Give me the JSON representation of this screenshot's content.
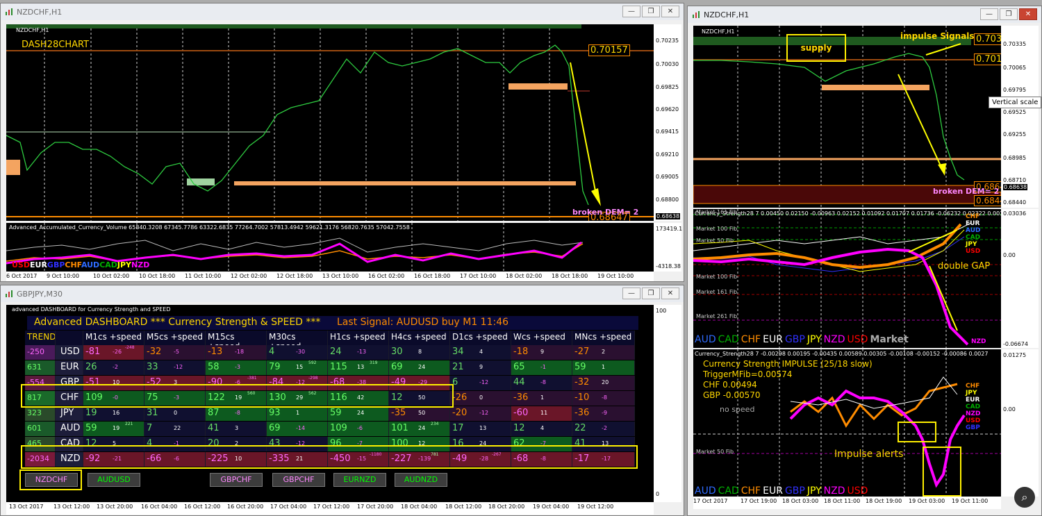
{
  "windows": {
    "top_left": {
      "title": "NZDCHF,H1"
    },
    "right": {
      "title": "NZDCHF,H1"
    },
    "bottom_left": {
      "title": "GBPJPY,M30"
    }
  },
  "top_left_chart": {
    "symbol": "NZDCHF,H1",
    "label": "DASH28CHART",
    "price_box": "0.70157",
    "price_box_low": "0.68647",
    "broken": "broken DEM= 2",
    "prices": [
      "0.70235",
      "0.70030",
      "0.69825",
      "0.69620",
      "0.69415",
      "0.69210",
      "0.69005",
      "0.68800",
      "0.68638"
    ],
    "indicator_text": "Advanced_Accumulated_Currency_Volume 65840.3208 67345.7786 63322.6835 77264.7002 57813.4942 59621.3176 56820.7635 57042.7558",
    "indicator_scale_top": "173419.1",
    "indicator_scale_bottom": "-4318.38",
    "currencies": [
      "USD",
      "EUR",
      "GBP",
      "CHF",
      "AUD",
      "CAD",
      "JPY",
      "NZD"
    ],
    "times": [
      "6 Oct 2017",
      "9 Oct 10:00",
      "10 Oct 02:00",
      "10 Oct 18:00",
      "11 Oct 10:00",
      "12 Oct 02:00",
      "12 Oct 18:00",
      "13 Oct 10:00",
      "16 Oct 02:00",
      "16 Oct 18:00",
      "17 Oct 10:00",
      "18 Oct 02:00",
      "18 Oct 18:00",
      "19 Oct 10:00"
    ]
  },
  "dashboard": {
    "caption": "advanced DASHBOARD for Currency Strength and SPEED",
    "title": "Advanced  DASHBOARD *** Currency Strength & SPEED ***",
    "last_signal": "Last Signal: AUDUSD buy M1 11:46",
    "scale_top": "100",
    "scale_bottom": "0",
    "headers": [
      "TREND",
      "",
      "M1cs +speed",
      "M5cs +speed",
      "M15cs +speed",
      "M30cs +speed",
      "H1cs +speed",
      "H4cs +speed",
      "D1cs +speed",
      "Wcs +speed",
      "MNcs +speed"
    ],
    "rows": [
      {
        "trend": "-250",
        "cur": "USD",
        "cells": [
          [
            "-81",
            "-26",
            "-248"
          ],
          [
            "-32",
            "-5",
            ""
          ],
          [
            "-13",
            "-18",
            ""
          ],
          [
            "4",
            "-30",
            ""
          ],
          [
            "24",
            "-13",
            ""
          ],
          [
            "30",
            "8",
            ""
          ],
          [
            "34",
            "4",
            ""
          ],
          [
            "-18",
            "9",
            ""
          ],
          [
            "-27",
            "2",
            ""
          ]
        ]
      },
      {
        "trend": "631",
        "cur": "EUR",
        "cells": [
          [
            "26",
            "-2",
            ""
          ],
          [
            "33",
            "-12",
            ""
          ],
          [
            "58",
            "-3",
            ""
          ],
          [
            "79",
            "15",
            "592"
          ],
          [
            "115",
            "13",
            "319"
          ],
          [
            "69",
            "24",
            ""
          ],
          [
            "21",
            "9",
            ""
          ],
          [
            "65",
            "-1",
            ""
          ],
          [
            "59",
            "1",
            ""
          ]
        ]
      },
      {
        "trend": "-554",
        "cur": "GBP",
        "cells": [
          [
            "-51",
            "10",
            ""
          ],
          [
            "-52",
            "3",
            ""
          ],
          [
            "-90",
            "-6",
            "-381"
          ],
          [
            "-84",
            "-12",
            "-298"
          ],
          [
            "-68",
            "-38",
            ""
          ],
          [
            "-49",
            "-29",
            ""
          ],
          [
            "6",
            "-12",
            ""
          ],
          [
            "44",
            "-8",
            ""
          ],
          [
            "-32",
            "20",
            ""
          ]
        ]
      },
      {
        "trend": "817",
        "cur": "CHF",
        "cells": [
          [
            "109",
            "-0",
            ""
          ],
          [
            "75",
            "-3",
            ""
          ],
          [
            "122",
            "19",
            "560"
          ],
          [
            "130",
            "29",
            "562"
          ],
          [
            "116",
            "42",
            ""
          ],
          [
            "12",
            "50",
            ""
          ],
          [
            "-26",
            "0",
            ""
          ],
          [
            "-36",
            "1",
            ""
          ],
          [
            "-10",
            "-8",
            ""
          ]
        ]
      },
      {
        "trend": "323",
        "cur": "JPY",
        "cells": [
          [
            "19",
            "16",
            ""
          ],
          [
            "31",
            "0",
            ""
          ],
          [
            "87",
            "-8",
            ""
          ],
          [
            "93",
            "1",
            ""
          ],
          [
            "59",
            "24",
            ""
          ],
          [
            "-35",
            "50",
            ""
          ],
          [
            "-20",
            "-12",
            ""
          ],
          [
            "-60",
            "11",
            ""
          ],
          [
            "-36",
            "-9",
            ""
          ]
        ]
      },
      {
        "trend": "601",
        "cur": "AUD",
        "cells": [
          [
            "59",
            "19",
            "221"
          ],
          [
            "7",
            "22",
            ""
          ],
          [
            "41",
            "3",
            ""
          ],
          [
            "69",
            "-14",
            ""
          ],
          [
            "109",
            "-6",
            ""
          ],
          [
            "101",
            "24",
            "234"
          ],
          [
            "17",
            "13",
            ""
          ],
          [
            "12",
            "4",
            ""
          ],
          [
            "22",
            "-2",
            ""
          ]
        ]
      },
      {
        "trend": "465",
        "cur": "CAD",
        "cells": [
          [
            "12",
            "5",
            ""
          ],
          [
            "4",
            "-1",
            ""
          ],
          [
            "20",
            "2",
            ""
          ],
          [
            "43",
            "-12",
            ""
          ],
          [
            "96",
            "-7",
            ""
          ],
          [
            "100",
            "12",
            ""
          ],
          [
            "16",
            "24",
            ""
          ],
          [
            "62",
            "-7",
            ""
          ],
          [
            "41",
            "13",
            ""
          ]
        ]
      },
      {
        "trend": "-2034",
        "cur": "NZD",
        "cells": [
          [
            "-92",
            "-21",
            ""
          ],
          [
            "-66",
            "-6",
            ""
          ],
          [
            "-225",
            "10",
            ""
          ],
          [
            "-335",
            "21",
            ""
          ],
          [
            "-450",
            "-15",
            "-1180"
          ],
          [
            "-227",
            "-139",
            "781"
          ],
          [
            "-49",
            "-28",
            "-267"
          ],
          [
            "-68",
            "-8",
            ""
          ],
          [
            "-17",
            "-17",
            ""
          ]
        ]
      }
    ],
    "buttons": [
      "NZDCHF",
      "AUDUSD",
      "GBPCHF",
      "GBPCHF",
      "EURNZD",
      "AUDNZD"
    ],
    "times": [
      "13 Oct 2017",
      "13 Oct 12:00",
      "13 Oct 20:00",
      "16 Oct 04:00",
      "16 Oct 12:00",
      "16 Oct 20:00",
      "17 Oct 04:00",
      "17 Oct 12:00",
      "17 Oct 20:00",
      "18 Oct 04:00",
      "18 Oct 12:00",
      "18 Oct 20:00",
      "19 Oct 04:00",
      "19 Oct 12:00"
    ]
  },
  "right_chart": {
    "symbol": "NZDCHF,H1",
    "supply": "supply",
    "impulse_signals": "impulse Signals",
    "price_box1": "0.7039",
    "price_box2": "0.7015",
    "price_box3": "0.6864",
    "price_box4": "0.6844",
    "tooltip": "Vertical scale",
    "broken": "broken DEM= 2",
    "prices": [
      "0.70335",
      "0.70065",
      "0.69795",
      "0.69525",
      "0.69255",
      "0.68985",
      "0.68710",
      "0.68638",
      "0.68440"
    ],
    "cs_header": "Currency_Strength28 7 0.00450 0.02150 -0.00963 0.02152 0.01092 0.01707 0.01736 -0.06232 0.02322 0.00387",
    "cs_scale": [
      "0.03036",
      "0.00",
      "-0.06674"
    ],
    "fib": [
      "Market 161 Fib",
      "Market 100 Fib",
      "Market 50 Fib",
      "Market 50 Fib",
      "Market 100 Fib",
      "Market 161 Fib",
      "Market 261 Fib"
    ],
    "double_gap": "double GAP",
    "legend": [
      "AUD",
      "CAD",
      "CHF",
      "EUR",
      "GBP",
      "JPY",
      "NZD",
      "USD"
    ],
    "market": "Market",
    "tags_top": [
      "NZD",
      "USD",
      "JPY",
      "CAD",
      "AUD",
      "EUR",
      "CHF"
    ],
    "imp_header": "Currency_Strength28 7 -0.00298 0.00195 -0.00435 0.00589 0.00305 -0.00108 -0.00152 -0.00086 0.0027",
    "imp_title": "Currency Strength IMPULSE (25/18 slow)",
    "trigger": "TriggerMFib=0.00574",
    "chf_val": "CHF 0.00494",
    "gbp_val": "GBP -0.00570",
    "no_speed": "no speed",
    "impulse_alerts": "Impulse alerts",
    "imp_scale": [
      "0.01275",
      "0.00"
    ],
    "imp_fib": "Market 50 Fib",
    "imp_tags": [
      "CHF",
      "JPY",
      "EUR",
      "CAD",
      "NZD",
      "USD",
      "GBP"
    ],
    "times": [
      "17 Oct 2017",
      "17 Oct 19:00",
      "18 Oct 03:00",
      "18 Oct 11:00",
      "18 Oct 19:00",
      "19 Oct 03:00",
      "19 Oct 11:00"
    ]
  },
  "colors": {
    "USD": "#ff0000",
    "EUR": "#ffffff",
    "GBP": "#3030ff",
    "CHF": "#ff8c00",
    "AUD": "#2f6bff",
    "CAD": "#00b000",
    "JPY": "#ffff00",
    "NZD": "#ff00ff",
    "yellow": "#fff000"
  }
}
